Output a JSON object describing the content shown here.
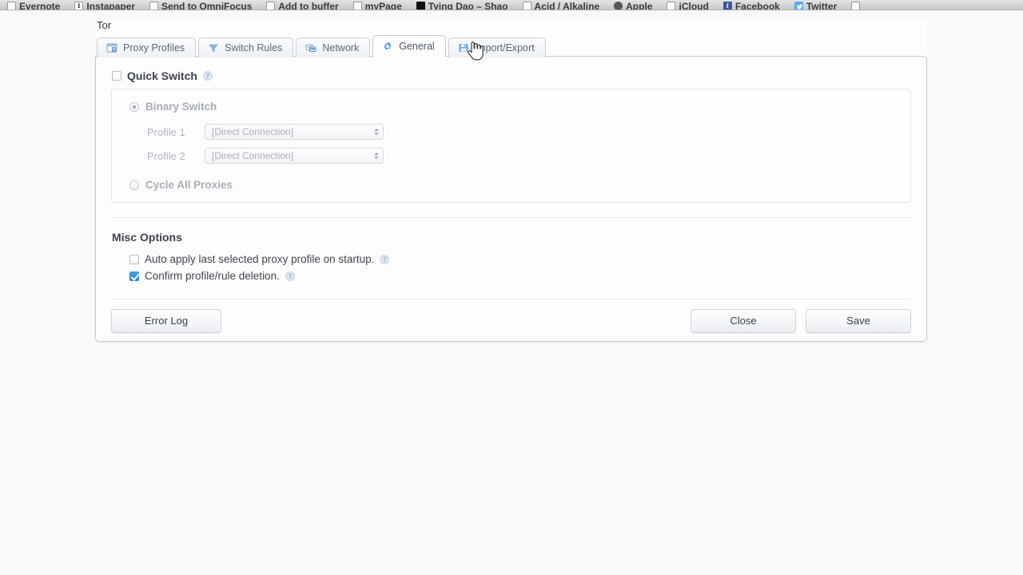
{
  "bookmarks": [
    {
      "label": "Evernote",
      "icon": "evernote-favicon",
      "has_icon": false
    },
    {
      "label": "Instapaper",
      "icon": "instapaper-favicon",
      "has_icon": true,
      "glyph": "I",
      "style": "instapaper"
    },
    {
      "label": "Send to OmniFocus",
      "icon": "omnifocus-favicon",
      "has_icon": true,
      "glyph": "",
      "style": ""
    },
    {
      "label": "Add to buffer",
      "icon": "buffer-favicon",
      "has_icon": true,
      "glyph": "",
      "style": ""
    },
    {
      "label": "myPage",
      "icon": "mypage-favicon",
      "has_icon": true,
      "glyph": "",
      "style": ""
    },
    {
      "label": "Tying Dao – Shao",
      "icon": "tyingdao-favicon",
      "has_icon": true,
      "glyph": "",
      "style": "tyingdao"
    },
    {
      "label": "Acid / Alkaline",
      "icon": "acid-alkaline-favicon",
      "has_icon": true,
      "glyph": "",
      "style": ""
    },
    {
      "label": "Apple",
      "icon": "apple-favicon",
      "has_icon": true,
      "glyph": "",
      "style": "apple"
    },
    {
      "label": "iCloud",
      "icon": "icloud-favicon",
      "has_icon": true,
      "glyph": "",
      "style": ""
    },
    {
      "label": "Facebook",
      "icon": "facebook-favicon",
      "has_icon": true,
      "glyph": "f",
      "style": "facebook"
    },
    {
      "label": "Twitter",
      "icon": "twitter-favicon",
      "has_icon": true,
      "glyph": "",
      "style": "twitter"
    }
  ],
  "dialog": {
    "title": "Tor",
    "tabs": [
      {
        "label": "Proxy Profiles",
        "icon": "proxy-profiles-icon",
        "active": false
      },
      {
        "label": "Switch Rules",
        "icon": "funnel-icon",
        "active": false
      },
      {
        "label": "Network",
        "icon": "network-icon",
        "active": false
      },
      {
        "label": "General",
        "icon": "gear-icon",
        "active": true
      },
      {
        "label": "Import/Export",
        "icon": "floppy-disk-icon",
        "active": false
      }
    ],
    "quick_switch": {
      "title": "Quick Switch",
      "enabled": false,
      "help": "?",
      "mode": "binary",
      "binary_switch": {
        "label": "Binary Switch",
        "selected": true,
        "profiles": [
          {
            "label": "Profile 1",
            "value": "[Direct Connection]"
          },
          {
            "label": "Profile 2",
            "value": "[Direct Connection]"
          }
        ]
      },
      "cycle_all": {
        "label": "Cycle All Proxies",
        "selected": false
      }
    },
    "misc_options": {
      "title": "Misc Options",
      "items": [
        {
          "label": "Auto apply last selected proxy profile on startup.",
          "checked": false,
          "help": "?"
        },
        {
          "label": "Confirm profile/rule deletion.",
          "checked": true,
          "help": "?"
        }
      ]
    },
    "footer": {
      "error_log": "Error Log",
      "close": "Close",
      "save": "Save"
    }
  },
  "colors": {
    "accent": "#5b9bd5",
    "checked_checkbox": "#2f8bdb",
    "page_background": "#f7f9fb",
    "tab_text": "#5d6874"
  }
}
